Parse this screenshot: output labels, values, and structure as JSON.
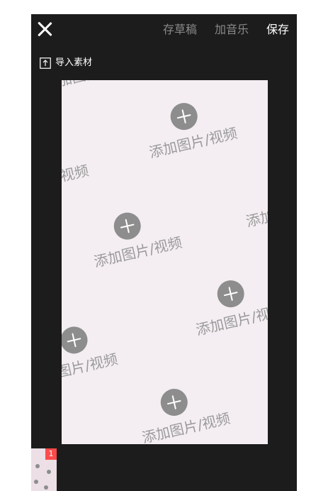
{
  "header": {
    "draft_label": "存草稿",
    "music_label": "加音乐",
    "save_label": "保存"
  },
  "toolbar": {
    "import_label": "导入素材"
  },
  "canvas": {
    "slot_label": "添加图片/视频",
    "slot_label_partial_a": "加图片",
    "slot_label_partial_b": "视频",
    "slot_label_partial_c": "添加",
    "slot_label_partial_d": "添加图片/视",
    "slot_label_partial_e": "图片/视频"
  },
  "timeline": {
    "clips": [
      {
        "badge": "1"
      }
    ]
  },
  "colors": {
    "background": "#1c1c1c",
    "canvas": "#f4eef2",
    "accent_badge": "#ff4b4b",
    "inactive_text": "#8a8a8a"
  },
  "icons": {
    "close": "close-icon",
    "import": "upload-icon",
    "add": "plus-icon"
  }
}
